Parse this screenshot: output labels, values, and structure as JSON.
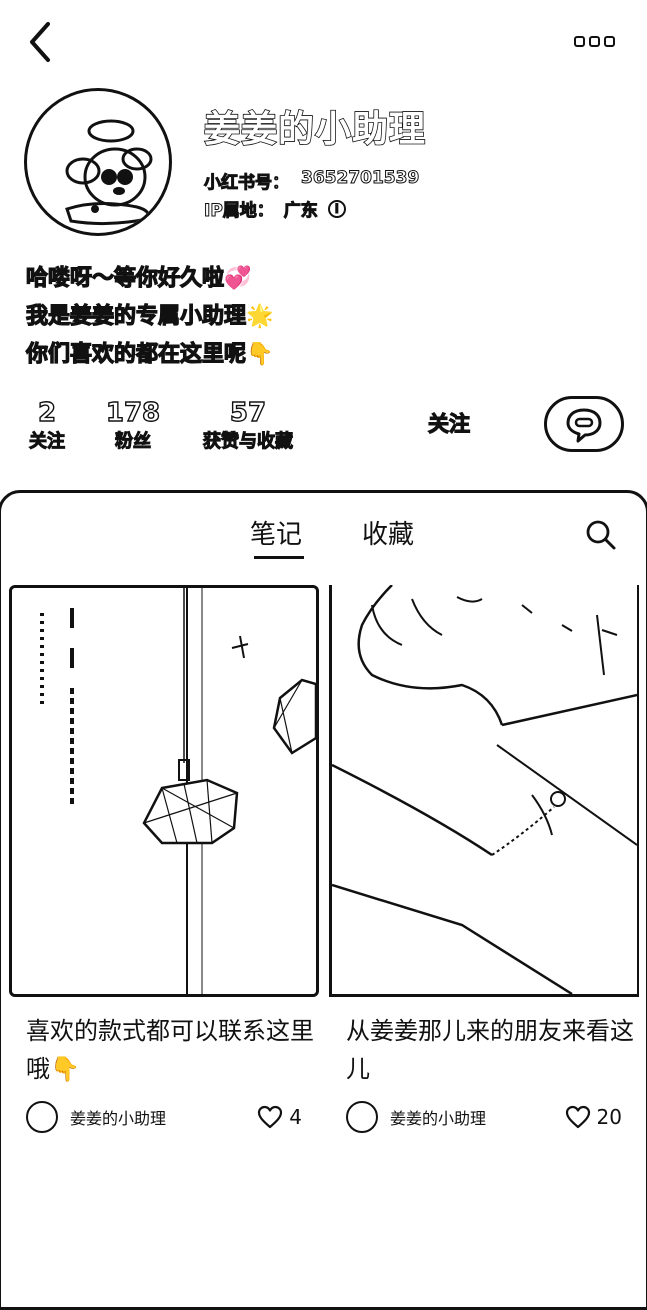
{
  "profile": {
    "name": "姜姜的小助理",
    "id_label": "小红书号：",
    "id_value": "3652701539",
    "ip_label": "IP属地：",
    "ip_value": "广东",
    "info_icon": "i"
  },
  "bio": {
    "line1": "哈喽呀～等你好久啦💞",
    "line2": "我是姜姜的专属小助理🌟",
    "line3": "你们喜欢的都在这里呢👇"
  },
  "stats": {
    "following_count": "2",
    "following_label": "关注",
    "followers_count": "178",
    "followers_label": "粉丝",
    "likes_count": "57",
    "likes_label": "获赞与收藏"
  },
  "actions": {
    "follow_label": "关注",
    "chat_icon": "chat-bubble-icon"
  },
  "tabs": [
    {
      "label": "笔记",
      "active": true
    },
    {
      "label": "收藏",
      "active": false
    }
  ],
  "notes": [
    {
      "title": "喜欢的款式都可以联系这里哦👇",
      "author": "姜姜的小助理",
      "likes": "4"
    },
    {
      "title": "从姜姜那儿来的朋友来看这儿",
      "author": "姜姜的小助理",
      "likes": "20"
    }
  ],
  "colors": {
    "ink": "#111111",
    "background": "#ffffff"
  }
}
